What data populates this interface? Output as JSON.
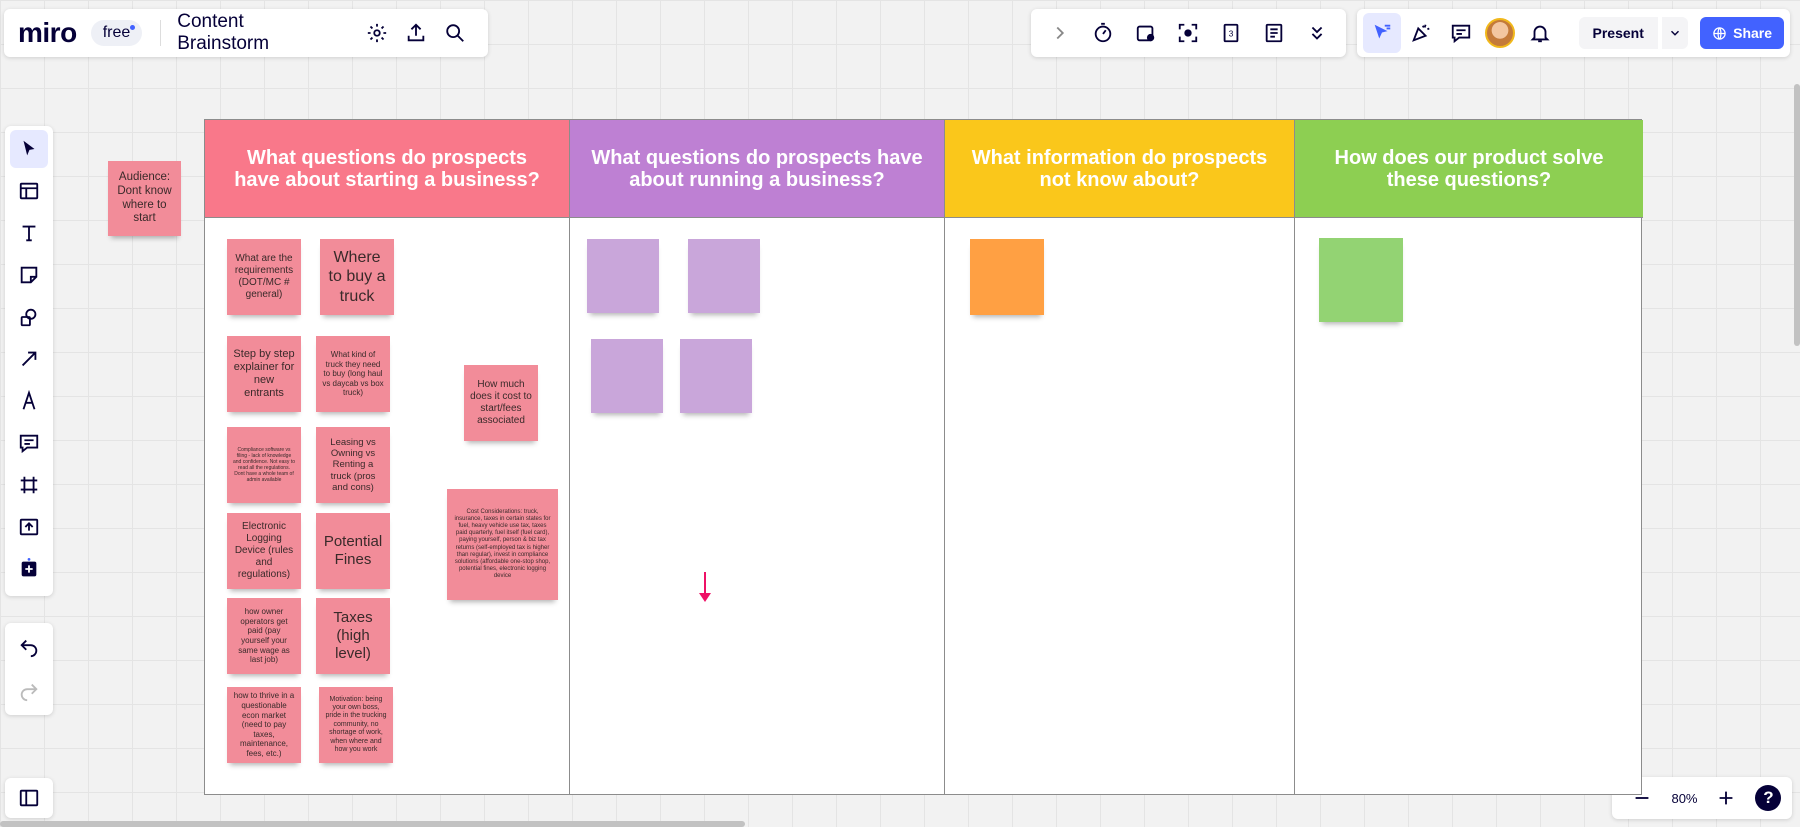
{
  "topbar": {
    "logo": "miro",
    "plan_badge": "free",
    "board_title": "Content Brainstorm"
  },
  "top_right": {
    "present_label": "Present",
    "share_label": "Share",
    "tools": [
      "chevron-right-icon",
      "timer-icon",
      "voting-icon",
      "focus-icon",
      "calendar-icon",
      "notes-icon",
      "more-icon"
    ]
  },
  "left_toolbar": {
    "tools": [
      "select-icon",
      "templates-icon",
      "text-icon",
      "sticky-note-icon",
      "shapes-icon",
      "connector-icon",
      "pen-icon",
      "comment-icon",
      "frame-icon",
      "upload-icon",
      "apps-icon"
    ]
  },
  "zoom": {
    "level": "80%",
    "help": "?"
  },
  "board": {
    "audience_note": "Audience: Dont know where to start",
    "columns": [
      {
        "title": "What questions do prospects have about starting a business?",
        "color": "#f9788a"
      },
      {
        "title": "What questions do prospects have about running a business?",
        "color": "#be80d3"
      },
      {
        "title": "What information do prospects not know about?",
        "color": "#fac71b"
      },
      {
        "title": "How does our product solve these questions?",
        "color": "#8dcf52"
      }
    ],
    "notes": [
      "What are the requirements (DOT/MC # general)",
      "Where to buy a truck",
      "Step by step explainer for new entrants",
      "What kind of truck they need to buy (long haul vs daycab vs box truck)",
      "Compliance software vs filing - lack of knowledge and confidence. Not easy to read all the regulations. Dont have a whole team of admin available",
      "Leasing vs Owning vs Renting a truck (pros and cons)",
      "Electronic Logging Device (rules and regulations)",
      "Potential Fines",
      "how owner operators get paid (pay yourself your same wage as last job)",
      "Taxes (high level)",
      "how to thrive in a questionable econ market (need to pay taxes, maintenance, fees, etc.)",
      "Motivation: being your own boss, pride in the trucking community, no shortage of work, when where and how you work",
      "How much does it cost to start/fees associated",
      "Cost Considerations: truck, insurance, taxes in certain states for fuel, heavy vehicle use tax, taxes paid quarterly, fuel itself (fuel card), paying yourself, person & biz tax returns (self-employed tax is higher than regular), invest in compliance solutions (affordable one-stop shop, potential fines, electronic logging device"
    ]
  }
}
